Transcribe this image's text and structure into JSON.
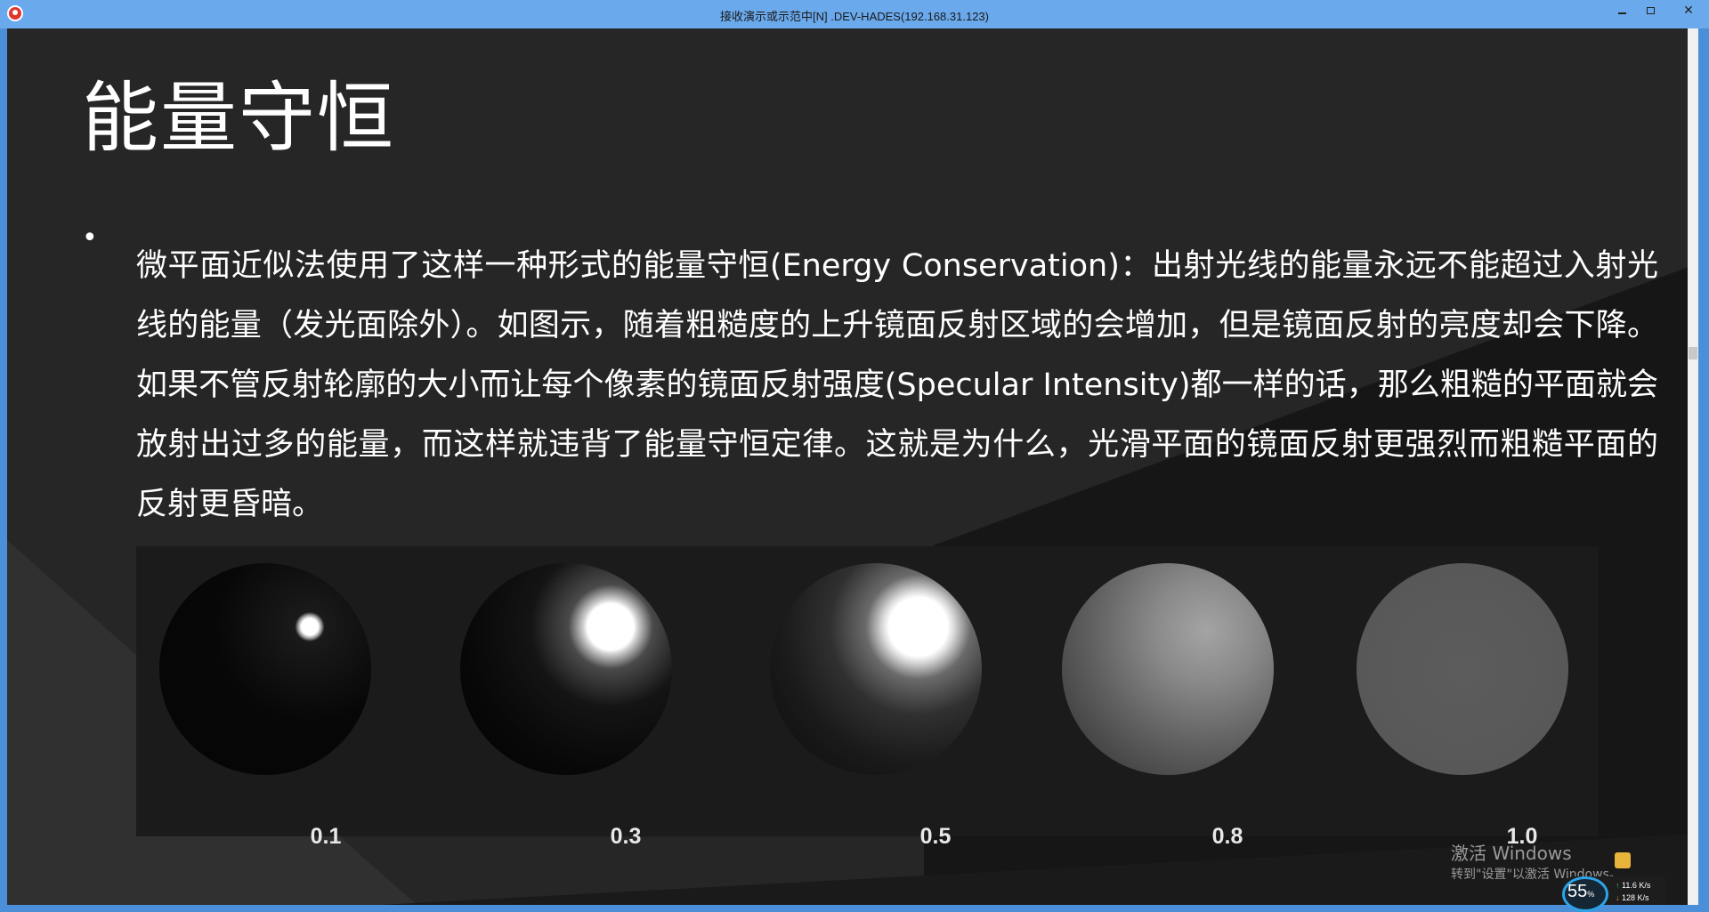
{
  "window": {
    "title": "接收演示或示范中[N] .DEV-HADES(192.168.31.123)",
    "controls": {
      "minimize": "–",
      "maximize": "□",
      "close": "✕"
    }
  },
  "slide": {
    "title": "能量守恒",
    "bullet_glyph": "•",
    "body": "微平面近似法使用了这样一种形式的能量守恒(Energy Conservation)：出射光线的能量永远不能超过入射光线的能量（发光面除外）。如图示，随着粗糙度的上升镜面反射区域的会增加，但是镜面反射的亮度却会下降。如果不管反射轮廓的大小而让每个像素的镜面反射强度(Specular Intensity)都一样的话，那么粗糙的平面就会放射出过多的能量，而这样就违背了能量守恒定律。这就是为什么，光滑平面的镜面反射更强烈而粗糙平面的反射更昏暗。",
    "figure": {
      "spheres": [
        {
          "roughness_label": "0.1"
        },
        {
          "roughness_label": "0.3"
        },
        {
          "roughness_label": "0.5"
        },
        {
          "roughness_label": "0.8"
        },
        {
          "roughness_label": "1.0"
        }
      ]
    }
  },
  "watermark": {
    "title": "激活 Windows",
    "subtitle": "转到\"设置\"以激活 Windows。"
  },
  "network_monitor": {
    "percent": "55",
    "percent_unit": "%",
    "upload": "11.6 K/s",
    "download": "128 K/s"
  },
  "colors": {
    "titlebar": "#6aa9ec",
    "slide_background": "#262626",
    "figure_background": "#1b1b1b",
    "text": "#ffffff"
  }
}
